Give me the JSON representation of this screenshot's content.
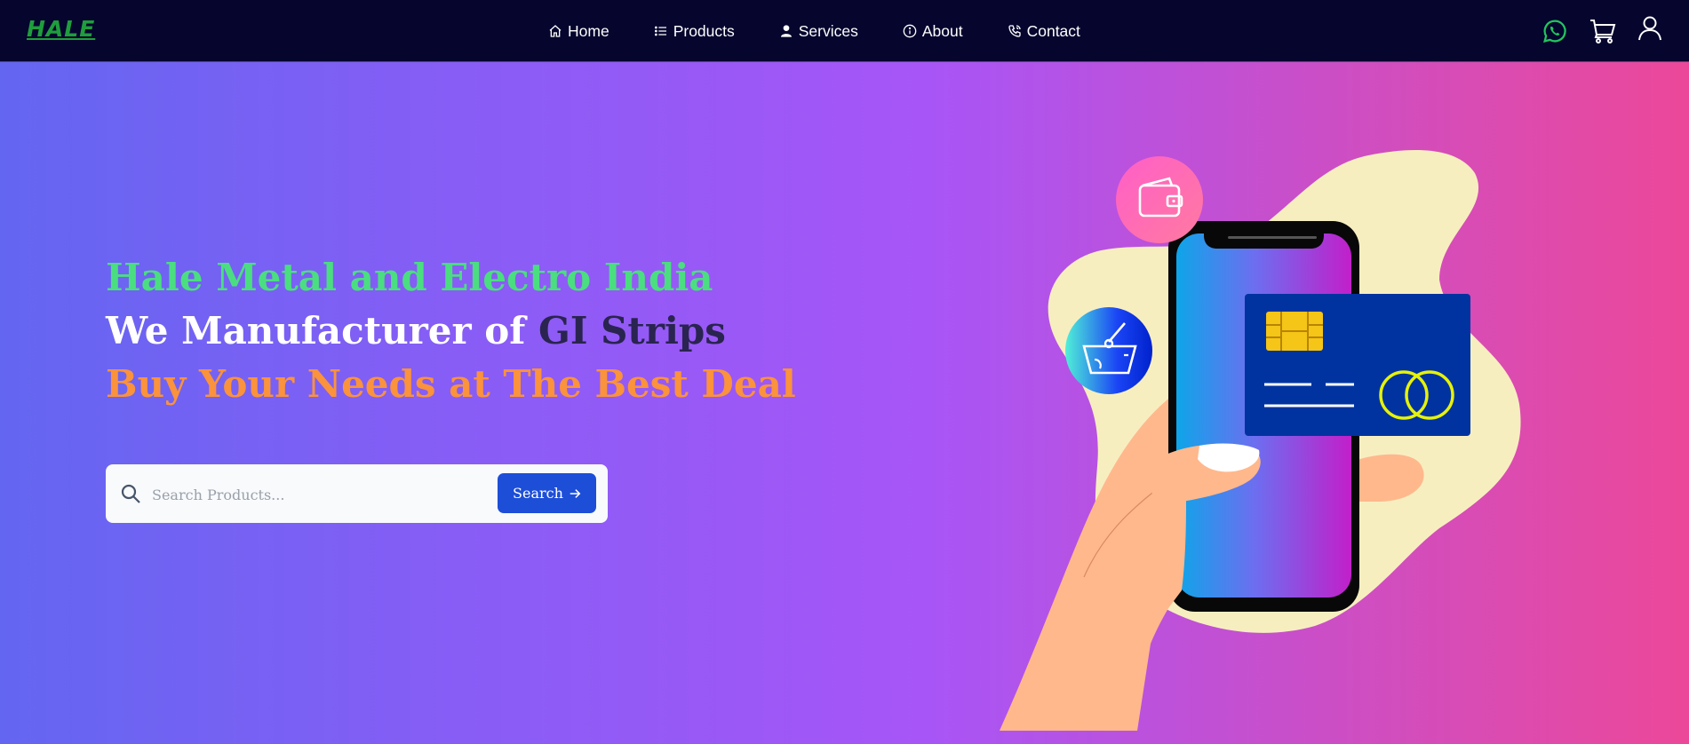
{
  "brand": {
    "logo_text": "HALE",
    "logo_color": "#1f9e3c"
  },
  "nav": {
    "items": [
      {
        "label": "Home",
        "icon": "home-icon"
      },
      {
        "label": "Products",
        "icon": "list-icon"
      },
      {
        "label": "Services",
        "icon": "user-icon"
      },
      {
        "label": "About",
        "icon": "info-icon"
      },
      {
        "label": "Contact",
        "icon": "phone-icon"
      }
    ],
    "right_icons": [
      "whatsapp-icon",
      "cart-icon",
      "user-account-icon"
    ]
  },
  "hero": {
    "line1": "Hale Metal and Electro India",
    "line2_prefix": "We Manufacturer of ",
    "line2_highlight": "GI Strips",
    "line3": "Buy Your Needs at The Best Deal",
    "colors": {
      "line1": "#4ade80",
      "line2": "#ffffff",
      "highlight": "#2a2450",
      "line3": "#fb923c"
    }
  },
  "search": {
    "placeholder": "Search Products...",
    "button_label": "Search",
    "button_color": "#1d4ed8"
  },
  "illustration": {
    "icons": [
      "wallet-icon",
      "basket-icon",
      "credit-card-chip-icon"
    ]
  }
}
